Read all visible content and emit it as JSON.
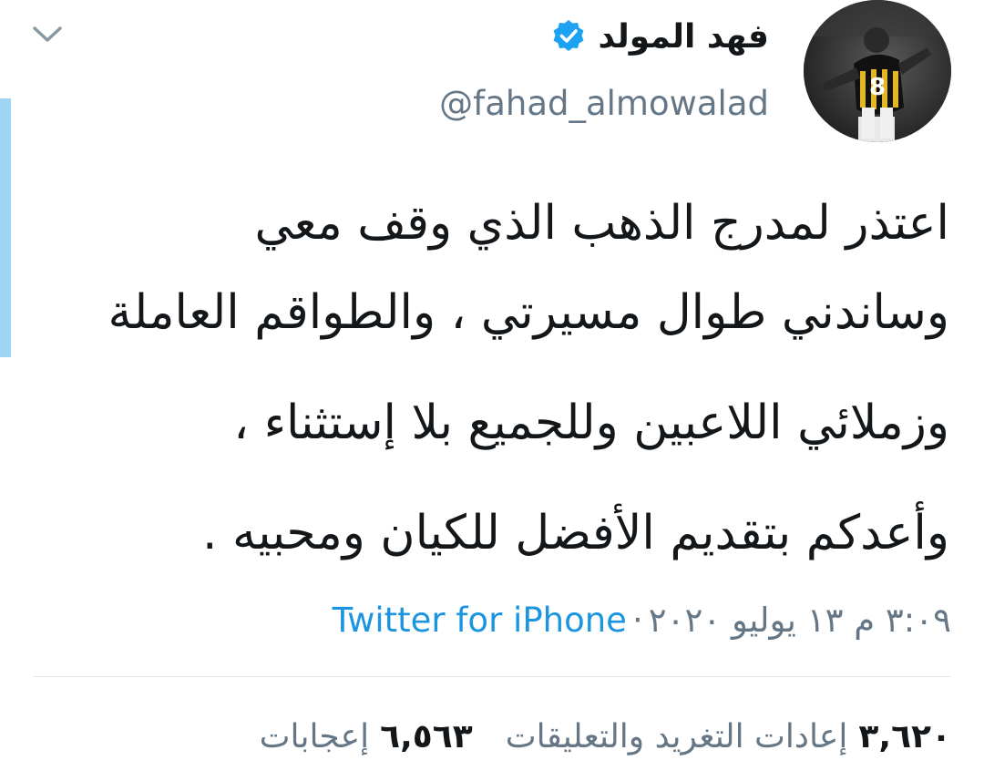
{
  "colors": {
    "accent_bar": "#9fd4f2",
    "verified_badge": "#1da1f2",
    "link": "#1b95e0",
    "secondary_text": "#657786",
    "primary_text": "#14171a",
    "divider": "#e1e8ed"
  },
  "header": {
    "collapse_icon": "chevron-down-icon"
  },
  "author": {
    "display_name": "فهد المولد",
    "handle": "@fahad_almowalad",
    "verified": true,
    "avatar_icon": "avatar-photo",
    "jersey_number": "8"
  },
  "tweet": {
    "lines": [
      "اعتذر لمدرج الذهب الذي وقف معي",
      "وساندني طوال مسيرتي ،  والطواقم العاملة",
      "وزملائي اللاعبين وللجميع بلا إستثناء ،",
      "وأعدكم بتقديم الأفضل للكيان ومحبيه ."
    ]
  },
  "meta": {
    "timestamp": "٣:٠٩ م ١٣ يوليو ٢٠٢٠",
    "separator": "·",
    "source": "Twitter for iPhone"
  },
  "stats": {
    "retweets_count": "٣,٦٢٠",
    "retweets_label": "إعادات التغريد والتعليقات",
    "likes_count": "٦,٥٦٣",
    "likes_label": "إعجابات"
  }
}
